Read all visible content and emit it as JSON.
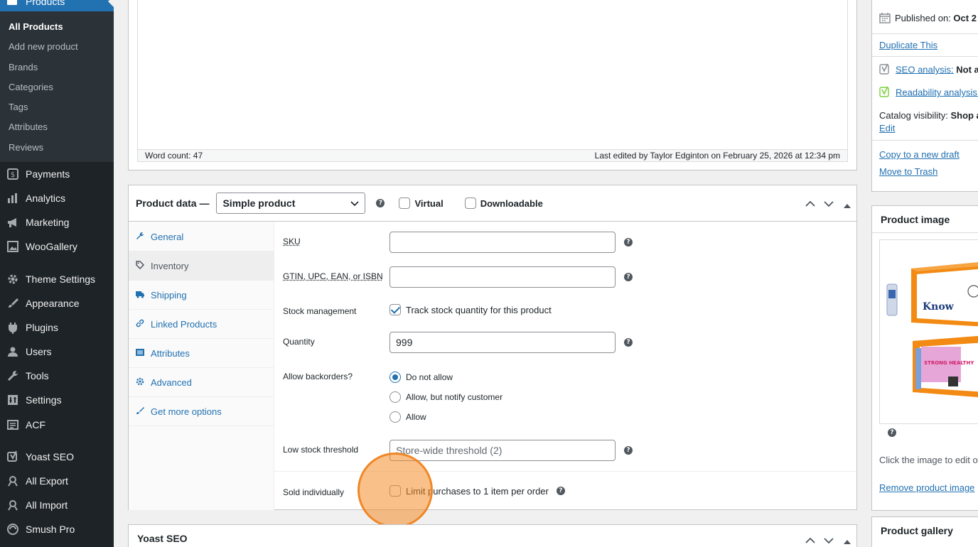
{
  "sidebar": {
    "current": "Products",
    "submenu": [
      "All Products",
      "Add new product",
      "Brands",
      "Categories",
      "Tags",
      "Attributes",
      "Reviews"
    ],
    "items": [
      {
        "label": "Payments",
        "icon": "dollar-icon"
      },
      {
        "label": "Analytics",
        "icon": "bar-chart-icon"
      },
      {
        "label": "Marketing",
        "icon": "megaphone-icon"
      },
      {
        "label": "WooGallery",
        "icon": "gallery-icon"
      },
      {
        "label": "Theme Settings",
        "icon": "gear-icon"
      },
      {
        "label": "Appearance",
        "icon": "paintbrush-icon"
      },
      {
        "label": "Plugins",
        "icon": "plug-icon"
      },
      {
        "label": "Users",
        "icon": "user-icon"
      },
      {
        "label": "Tools",
        "icon": "wrench-icon"
      },
      {
        "label": "Settings",
        "icon": "sliders-icon"
      },
      {
        "label": "ACF",
        "icon": "acf-icon"
      },
      {
        "label": "Yoast SEO",
        "icon": "yoast-icon"
      },
      {
        "label": "All Export",
        "icon": "export-icon"
      },
      {
        "label": "All Import",
        "icon": "import-icon"
      },
      {
        "label": "Smush Pro",
        "icon": "smush-icon"
      }
    ]
  },
  "editor": {
    "word_count": "Word count: 47",
    "last_edited": "Last edited by Taylor Edginton on February 25, 2026 at 12:34 pm"
  },
  "product_data": {
    "title": "Product data —",
    "type": "Simple product",
    "virtual_label": "Virtual",
    "downloadable_label": "Downloadable",
    "tabs": [
      "General",
      "Inventory",
      "Shipping",
      "Linked Products",
      "Attributes",
      "Advanced",
      "Get more options"
    ],
    "active_tab": "Inventory",
    "fields": {
      "sku_label": "SKU",
      "sku_value": "",
      "gtin_label": "GTIN, UPC, EAN, or ISBN",
      "gtin_value": "",
      "stock_mgmt_label": "Stock management",
      "stock_mgmt_check": "Track stock quantity for this product",
      "quantity_label": "Quantity",
      "quantity_value": "999",
      "backorders_label": "Allow backorders?",
      "backorder_options": [
        "Do not allow",
        "Allow, but notify customer",
        "Allow"
      ],
      "backorder_selected": "Do not allow",
      "low_stock_label": "Low stock threshold",
      "low_stock_placeholder": "Store-wide threshold (2)",
      "sold_individually_label": "Sold individually",
      "sold_individually_check": "Limit purchases to 1 item per order"
    }
  },
  "yoast": {
    "title": "Yoast SEO"
  },
  "publish": {
    "published_on": "Published on:",
    "published_date": "Oct 2",
    "duplicate": "Duplicate This",
    "seo_analysis": "SEO analysis:",
    "seo_value": "Not av",
    "readability": "Readability analysis:",
    "catalog_visibility": "Catalog visibility:",
    "catalog_value": "Shop a",
    "edit": "Edit",
    "copy_draft": "Copy to a new draft",
    "trash": "Move to Trash"
  },
  "product_image": {
    "title": "Product image",
    "hint": "Click the image to edit o",
    "remove": "Remove product image",
    "box1_text": "Know",
    "box2_text": "STRONG HEALTHY"
  },
  "product_gallery": {
    "title": "Product gallery"
  },
  "colors": {
    "accent": "#2271b1",
    "sidebar": "#1d2327",
    "highlight": "#f58c28"
  }
}
